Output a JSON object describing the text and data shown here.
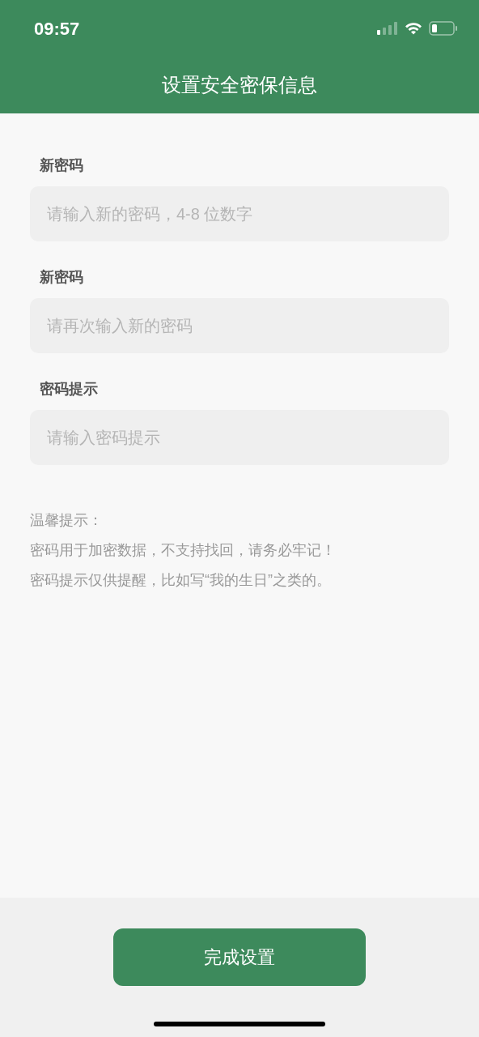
{
  "status_bar": {
    "time": "09:57"
  },
  "header": {
    "title": "设置安全密保信息"
  },
  "fields": [
    {
      "label": "新密码",
      "placeholder": "请输入新的密码，4-8 位数字"
    },
    {
      "label": "新密码",
      "placeholder": "请再次输入新的密码"
    },
    {
      "label": "密码提示",
      "placeholder": "请输入密码提示"
    }
  ],
  "tips": {
    "title": "温馨提示：",
    "lines": [
      "密码用于加密数据，不支持找回，请务必牢记！",
      "密码提示仅供提醒，比如写“我的生日”之类的。"
    ]
  },
  "submit_button": "完成设置"
}
